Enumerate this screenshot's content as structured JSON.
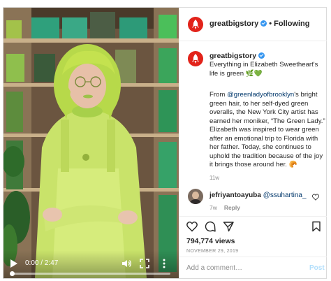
{
  "post": {
    "username": "greatbigstory",
    "follow_status": "Following",
    "separator": "•"
  },
  "video": {
    "current_time": "0:00",
    "duration": "2:47",
    "time_display": "0:00 / 2:47",
    "progress_fraction": 0.0
  },
  "caption": {
    "username": "greatbigstory",
    "headline": "Everything in Elizabeth Sweetheart's life is green 🌿💚",
    "body_prefix": "From ",
    "mention": "@greenladyofbrooklyn",
    "body_rest": "'s bright green hair, to her self-dyed green overalls, the New York City artist has earned her moniker, “The Green Lady.” Elizabeth was inspired to wear green after an emotional trip to Florida with her father. Today, she continues to uphold the tradition because of the joy it brings those around her. 🥐",
    "age": "11w"
  },
  "comment": {
    "username": "jefriyantoayuba",
    "mention": "@ssuhartina_",
    "age": "7w",
    "reply_label": "Reply"
  },
  "stats": {
    "views": "794,774 views",
    "date": "NOVEMBER 29, 2019"
  },
  "add_comment": {
    "placeholder": "Add a comment…",
    "post_label": "Post"
  },
  "colors": {
    "brand_red": "#e2231a",
    "verified_blue": "#3897f0",
    "mention_blue": "#00376b",
    "post_disabled": "#b2dffc",
    "muted_text": "#8e8e8e"
  },
  "icons": {
    "play": "play-icon",
    "volume": "volume-icon",
    "fullscreen": "fullscreen-icon",
    "more": "more-icon",
    "like": "heart-icon",
    "comment": "comment-icon",
    "share": "send-icon",
    "save": "bookmark-icon",
    "avatar_logo": "rocket-icon"
  }
}
